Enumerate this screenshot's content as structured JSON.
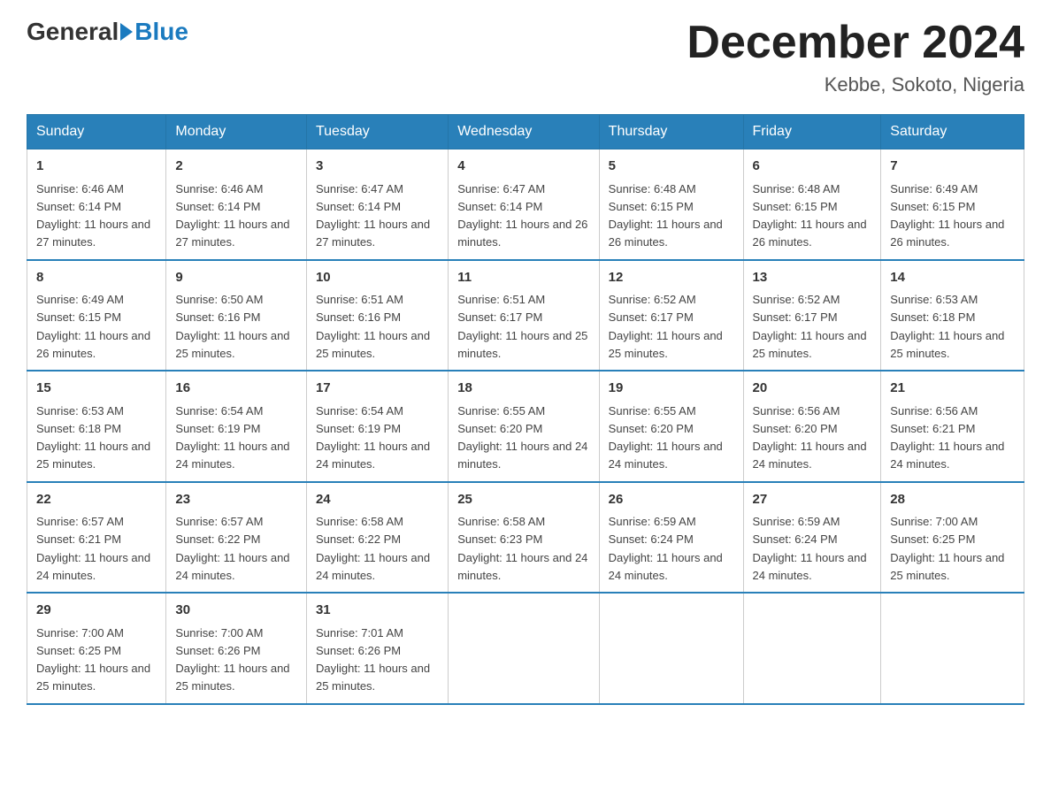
{
  "logo": {
    "general": "General",
    "blue": "Blue"
  },
  "title": "December 2024",
  "location": "Kebbe, Sokoto, Nigeria",
  "weekdays": [
    "Sunday",
    "Monday",
    "Tuesday",
    "Wednesday",
    "Thursday",
    "Friday",
    "Saturday"
  ],
  "weeks": [
    [
      {
        "day": "1",
        "sunrise": "6:46 AM",
        "sunset": "6:14 PM",
        "daylight": "11 hours and 27 minutes."
      },
      {
        "day": "2",
        "sunrise": "6:46 AM",
        "sunset": "6:14 PM",
        "daylight": "11 hours and 27 minutes."
      },
      {
        "day": "3",
        "sunrise": "6:47 AM",
        "sunset": "6:14 PM",
        "daylight": "11 hours and 27 minutes."
      },
      {
        "day": "4",
        "sunrise": "6:47 AM",
        "sunset": "6:14 PM",
        "daylight": "11 hours and 26 minutes."
      },
      {
        "day": "5",
        "sunrise": "6:48 AM",
        "sunset": "6:15 PM",
        "daylight": "11 hours and 26 minutes."
      },
      {
        "day": "6",
        "sunrise": "6:48 AM",
        "sunset": "6:15 PM",
        "daylight": "11 hours and 26 minutes."
      },
      {
        "day": "7",
        "sunrise": "6:49 AM",
        "sunset": "6:15 PM",
        "daylight": "11 hours and 26 minutes."
      }
    ],
    [
      {
        "day": "8",
        "sunrise": "6:49 AM",
        "sunset": "6:15 PM",
        "daylight": "11 hours and 26 minutes."
      },
      {
        "day": "9",
        "sunrise": "6:50 AM",
        "sunset": "6:16 PM",
        "daylight": "11 hours and 25 minutes."
      },
      {
        "day": "10",
        "sunrise": "6:51 AM",
        "sunset": "6:16 PM",
        "daylight": "11 hours and 25 minutes."
      },
      {
        "day": "11",
        "sunrise": "6:51 AM",
        "sunset": "6:17 PM",
        "daylight": "11 hours and 25 minutes."
      },
      {
        "day": "12",
        "sunrise": "6:52 AM",
        "sunset": "6:17 PM",
        "daylight": "11 hours and 25 minutes."
      },
      {
        "day": "13",
        "sunrise": "6:52 AM",
        "sunset": "6:17 PM",
        "daylight": "11 hours and 25 minutes."
      },
      {
        "day": "14",
        "sunrise": "6:53 AM",
        "sunset": "6:18 PM",
        "daylight": "11 hours and 25 minutes."
      }
    ],
    [
      {
        "day": "15",
        "sunrise": "6:53 AM",
        "sunset": "6:18 PM",
        "daylight": "11 hours and 25 minutes."
      },
      {
        "day": "16",
        "sunrise": "6:54 AM",
        "sunset": "6:19 PM",
        "daylight": "11 hours and 24 minutes."
      },
      {
        "day": "17",
        "sunrise": "6:54 AM",
        "sunset": "6:19 PM",
        "daylight": "11 hours and 24 minutes."
      },
      {
        "day": "18",
        "sunrise": "6:55 AM",
        "sunset": "6:20 PM",
        "daylight": "11 hours and 24 minutes."
      },
      {
        "day": "19",
        "sunrise": "6:55 AM",
        "sunset": "6:20 PM",
        "daylight": "11 hours and 24 minutes."
      },
      {
        "day": "20",
        "sunrise": "6:56 AM",
        "sunset": "6:20 PM",
        "daylight": "11 hours and 24 minutes."
      },
      {
        "day": "21",
        "sunrise": "6:56 AM",
        "sunset": "6:21 PM",
        "daylight": "11 hours and 24 minutes."
      }
    ],
    [
      {
        "day": "22",
        "sunrise": "6:57 AM",
        "sunset": "6:21 PM",
        "daylight": "11 hours and 24 minutes."
      },
      {
        "day": "23",
        "sunrise": "6:57 AM",
        "sunset": "6:22 PM",
        "daylight": "11 hours and 24 minutes."
      },
      {
        "day": "24",
        "sunrise": "6:58 AM",
        "sunset": "6:22 PM",
        "daylight": "11 hours and 24 minutes."
      },
      {
        "day": "25",
        "sunrise": "6:58 AM",
        "sunset": "6:23 PM",
        "daylight": "11 hours and 24 minutes."
      },
      {
        "day": "26",
        "sunrise": "6:59 AM",
        "sunset": "6:24 PM",
        "daylight": "11 hours and 24 minutes."
      },
      {
        "day": "27",
        "sunrise": "6:59 AM",
        "sunset": "6:24 PM",
        "daylight": "11 hours and 24 minutes."
      },
      {
        "day": "28",
        "sunrise": "7:00 AM",
        "sunset": "6:25 PM",
        "daylight": "11 hours and 25 minutes."
      }
    ],
    [
      {
        "day": "29",
        "sunrise": "7:00 AM",
        "sunset": "6:25 PM",
        "daylight": "11 hours and 25 minutes."
      },
      {
        "day": "30",
        "sunrise": "7:00 AM",
        "sunset": "6:26 PM",
        "daylight": "11 hours and 25 minutes."
      },
      {
        "day": "31",
        "sunrise": "7:01 AM",
        "sunset": "6:26 PM",
        "daylight": "11 hours and 25 minutes."
      },
      null,
      null,
      null,
      null
    ]
  ]
}
